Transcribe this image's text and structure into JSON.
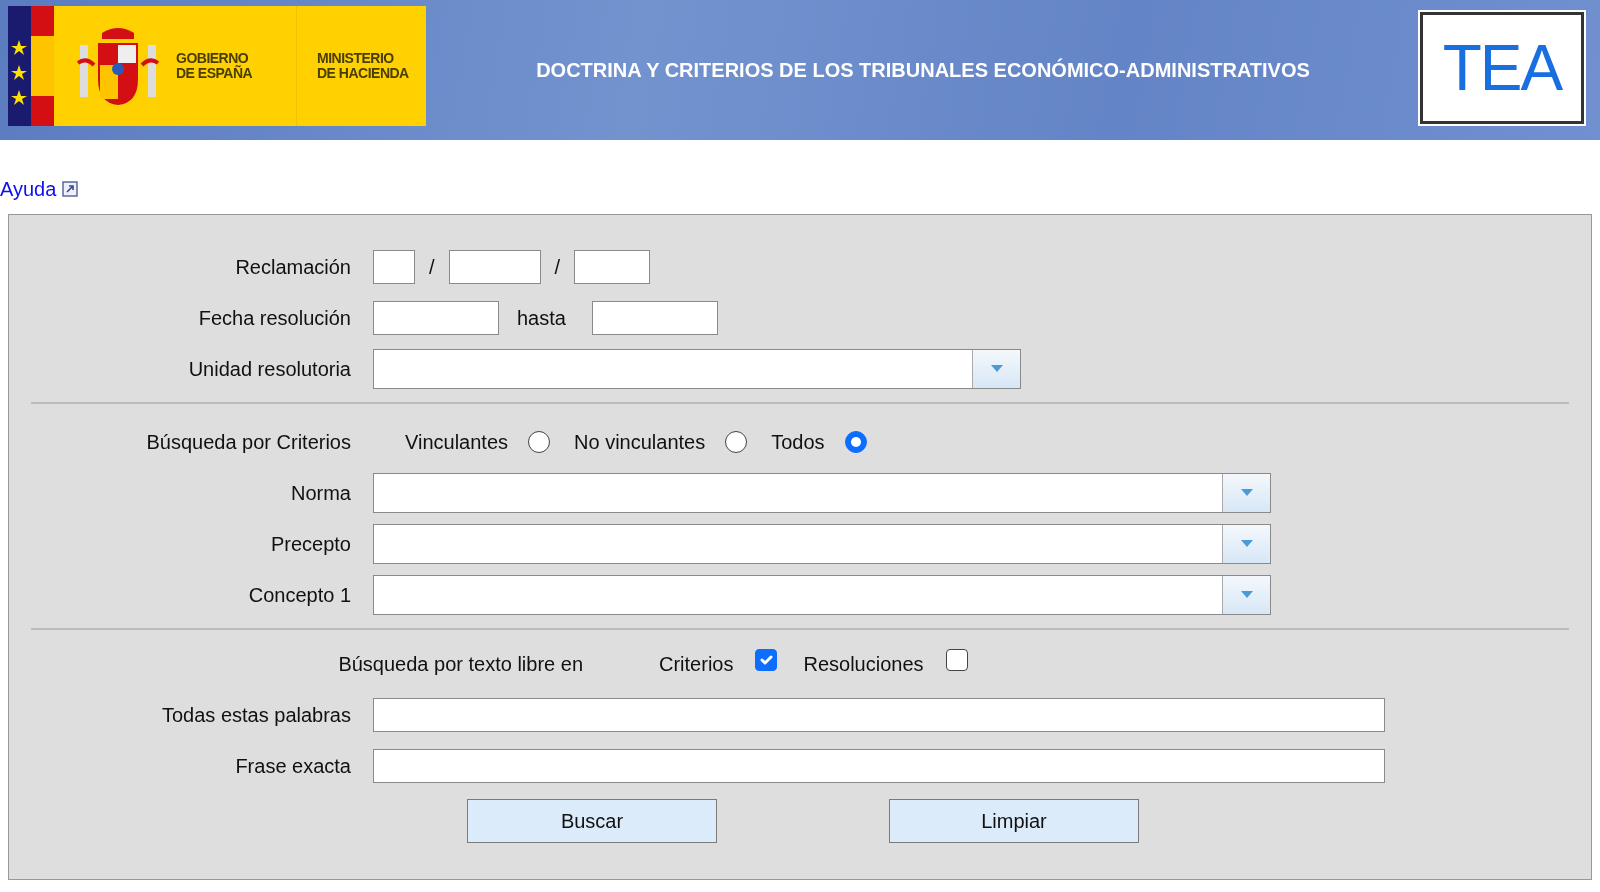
{
  "header": {
    "brand_lines": [
      "GOBIERNO",
      "DE ESPAÑA"
    ],
    "ministry_lines": [
      "MINISTERIO",
      "DE HACIENDA"
    ],
    "title": "DOCTRINA Y CRITERIOS DE LOS TRIBUNALES ECONÓMICO-ADMINISTRATIVOS",
    "logo_text": "TEA"
  },
  "help_link": "Ayuda",
  "sections": [
    {
      "rows": [
        {
          "kind": "claim",
          "label": "Reclamación",
          "separators": [
            "/",
            "/"
          ]
        },
        {
          "kind": "range",
          "label": "Fecha resolución",
          "between": "hasta"
        },
        {
          "kind": "select",
          "label": "Unidad resolutoria"
        }
      ]
    },
    {
      "rows": [
        {
          "kind": "radios",
          "label": "Búsqueda por Criterios",
          "options": [
            {
              "label": "Vinculantes",
              "selected": false
            },
            {
              "label": "No vinculantes",
              "selected": false
            },
            {
              "label": "Todos",
              "selected": true
            }
          ]
        },
        {
          "kind": "select",
          "label": "Norma"
        },
        {
          "kind": "select",
          "label": "Precepto"
        },
        {
          "kind": "select",
          "label": "Concepto 1"
        }
      ]
    },
    {
      "rows": [
        {
          "kind": "checks",
          "label": "Búsqueda por texto libre en",
          "options": [
            {
              "label": "Criterios",
              "checked": true
            },
            {
              "label": "Resoluciones",
              "checked": false
            }
          ]
        },
        {
          "kind": "text",
          "label": "Todas estas palabras"
        },
        {
          "kind": "text",
          "label": "Frase exacta"
        }
      ]
    }
  ],
  "buttons": [
    "Buscar",
    "Limpiar"
  ]
}
